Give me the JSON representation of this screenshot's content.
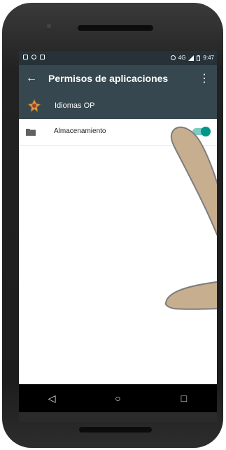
{
  "status_bar": {
    "time": "9:47",
    "network": "4G",
    "icons_left": [
      "image-icon",
      "wifi-icon",
      "notification-icon"
    ],
    "icons_right": [
      "alarm-icon",
      "signal-icon",
      "battery-icon"
    ]
  },
  "app_bar": {
    "title": "Permisos de aplicaciones",
    "back_icon": "arrow-left",
    "menu_icon": "more-vertical",
    "color": "#37474f"
  },
  "app_info": {
    "name": "Idiomas OP"
  },
  "permissions": [
    {
      "label": "Almacenamiento",
      "icon": "folder-icon",
      "enabled": true
    }
  ],
  "nav_bar": {
    "back": "◁",
    "home": "○",
    "recents": "□"
  },
  "colors": {
    "statusbar": "#263238",
    "toolbar": "#37474f",
    "accent": "#009688"
  }
}
